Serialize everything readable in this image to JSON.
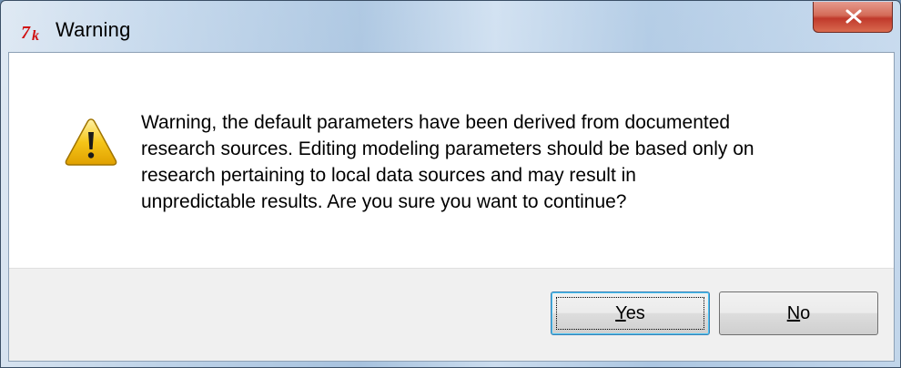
{
  "window": {
    "title": "Warning",
    "close_glyph": "x"
  },
  "icons": {
    "app": "tk-feather-icon",
    "message": "warning-triangle-icon",
    "close": "close-icon"
  },
  "message": {
    "lines": [
      "Warning, the default parameters have been derived from documented",
      "research sources. Editing modeling parameters should be based only on",
      "research pertaining to local data sources and may result in",
      "unpredictable results. Are you sure you want to continue?"
    ]
  },
  "buttons": {
    "yes": {
      "mnemonic": "Y",
      "rest": "es"
    },
    "no": {
      "mnemonic": "N",
      "rest": "o"
    }
  },
  "colors": {
    "warning_yellow": "#f5c518",
    "tk_red": "#d01010",
    "close_red": "#c0392b"
  }
}
